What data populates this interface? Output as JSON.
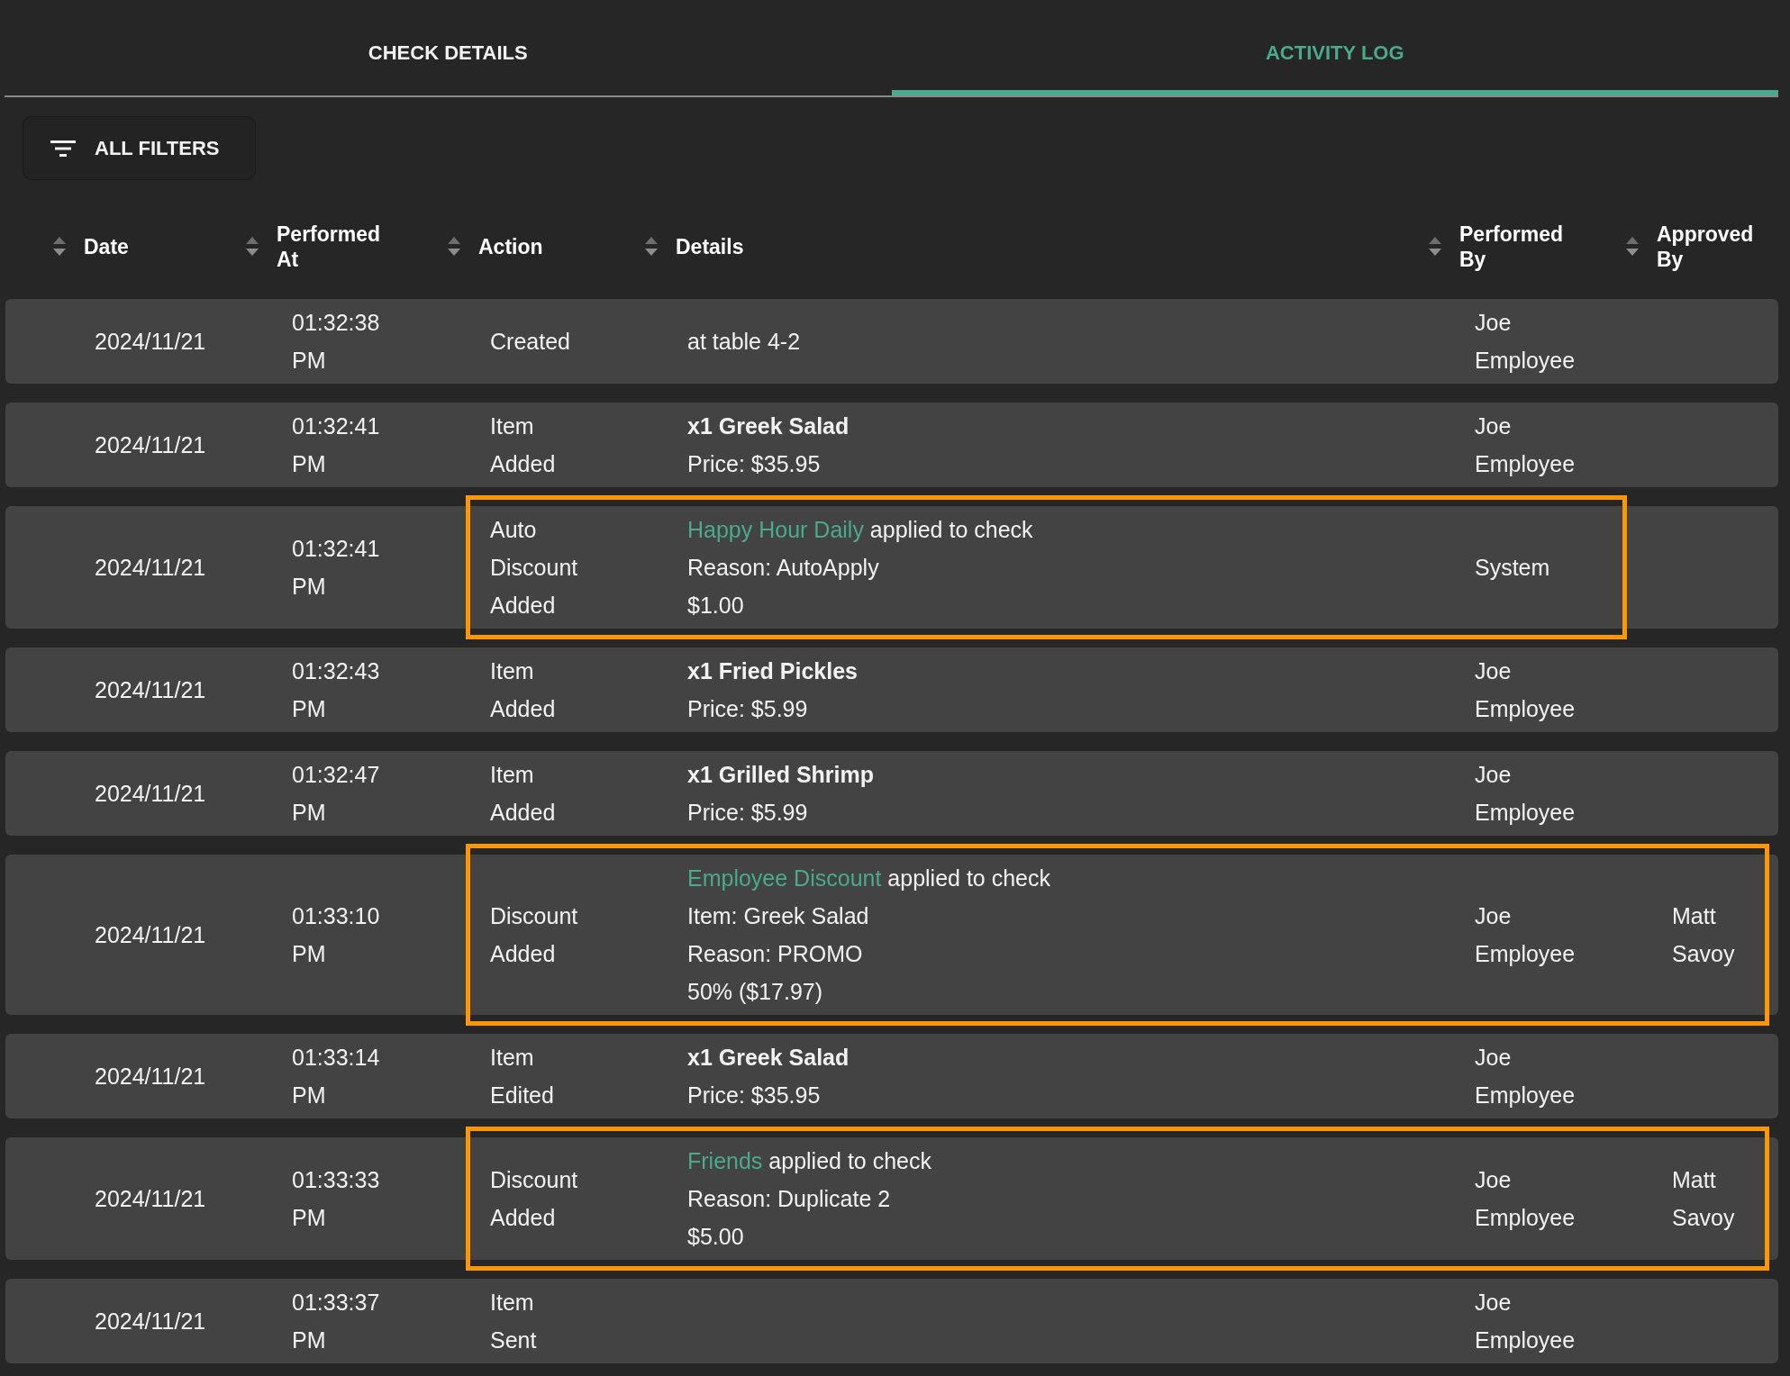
{
  "tabs": [
    {
      "label": "CHECK DETAILS",
      "selected": false
    },
    {
      "label": "ACTIVITY LOG",
      "selected": true
    }
  ],
  "filters_button": {
    "label": "ALL FILTERS"
  },
  "table": {
    "columns": [
      "Date",
      "Performed At",
      "Action",
      "Details",
      "Performed By",
      "Approved By"
    ],
    "rows": [
      {
        "date": "2024/11/21",
        "performed_at": "01:32:38 PM",
        "action": "Created",
        "details": [
          {
            "kind": "text",
            "text": "at table 4-2"
          }
        ],
        "performed_by": "Joe Employee",
        "highlighted": false
      },
      {
        "date": "2024/11/21",
        "performed_at": "01:32:41 PM",
        "action": "Item Added",
        "details": [
          {
            "kind": "item",
            "text": "x1 Greek Salad"
          },
          {
            "kind": "text",
            "text": "Price: $35.95"
          }
        ],
        "performed_by": "Joe Employee",
        "highlighted": false
      },
      {
        "date": "2024/11/21",
        "performed_at": "01:32:41 PM",
        "action": "Auto Discount Added",
        "details": [
          {
            "kind": "discount",
            "name": "Happy Hour Daily",
            "text": "applied to check"
          },
          {
            "kind": "text",
            "text": "Reason: AutoApply"
          },
          {
            "kind": "text",
            "text": "$1.00"
          }
        ],
        "performed_by": "System",
        "highlighted": true
      },
      {
        "date": "2024/11/21",
        "performed_at": "01:32:43 PM",
        "action": "Item Added",
        "details": [
          {
            "kind": "item",
            "text": "x1 Fried Pickles"
          },
          {
            "kind": "text",
            "text": "Price: $5.99"
          }
        ],
        "performed_by": "Joe Employee",
        "highlighted": false
      },
      {
        "date": "2024/11/21",
        "performed_at": "01:32:47 PM",
        "action": "Item Added",
        "details": [
          {
            "kind": "item",
            "text": "x1 Grilled Shrimp"
          },
          {
            "kind": "text",
            "text": "Price: $5.99"
          }
        ],
        "performed_by": "Joe Employee",
        "highlighted": false
      },
      {
        "date": "2024/11/21",
        "performed_at": "01:33:10 PM",
        "action": "Discount Added",
        "details": [
          {
            "kind": "discount",
            "name": "Employee Discount",
            "text": "applied to check"
          },
          {
            "kind": "text",
            "text": "Item: Greek Salad"
          },
          {
            "kind": "text",
            "text": "Reason: PROMO"
          },
          {
            "kind": "text",
            "text": "50% ($17.97)"
          }
        ],
        "performed_by": "Joe Employee",
        "approved_by": "Matt Savoy",
        "highlighted": true
      },
      {
        "date": "2024/11/21",
        "performed_at": "01:33:14 PM",
        "action": "Item Edited",
        "details": [
          {
            "kind": "item",
            "text": "x1 Greek Salad"
          },
          {
            "kind": "text",
            "text": "Price: $35.95"
          }
        ],
        "performed_by": "Joe Employee",
        "highlighted": false
      },
      {
        "date": "2024/11/21",
        "performed_at": "01:33:33 PM",
        "action": "Discount Added",
        "details": [
          {
            "kind": "discount",
            "name": "Friends",
            "text": "applied to check"
          },
          {
            "kind": "text",
            "text": "Reason: Duplicate 2"
          },
          {
            "kind": "text",
            "text": "$5.00"
          }
        ],
        "performed_by": "Joe Employee",
        "approved_by": "Matt Savoy",
        "highlighted": true
      },
      {
        "date": "2024/11/21",
        "performed_at": "01:33:37 PM",
        "action": "Item Sent",
        "performed_by": "Joe Employee",
        "highlighted": false
      }
    ]
  }
}
